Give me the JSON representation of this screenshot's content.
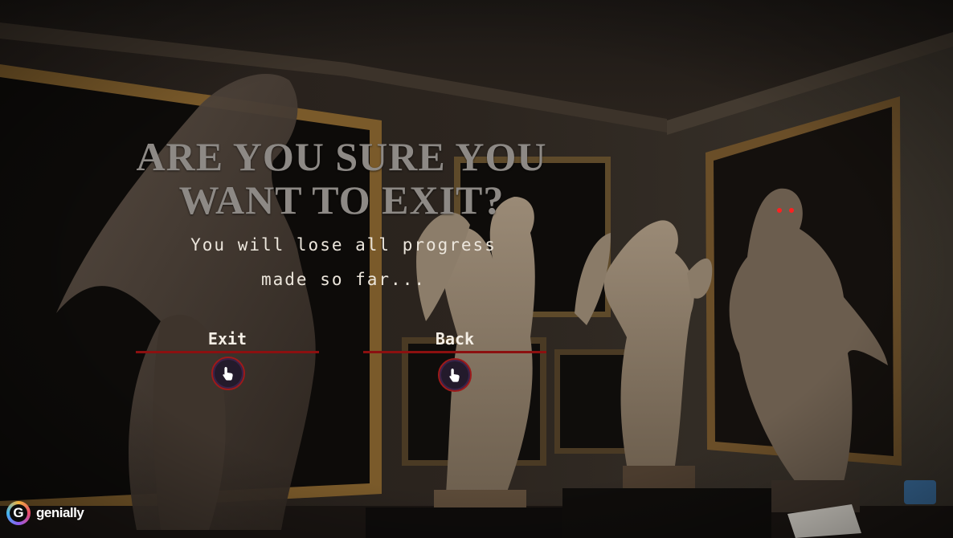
{
  "dialog": {
    "title_line1": "ARE YOU SURE YOU",
    "title_line2": "WANT TO EXIT?",
    "subtitle_line1": "You will lose all progress",
    "subtitle_line2": "made so far..."
  },
  "buttons": {
    "exit_label": "Exit",
    "back_label": "Back"
  },
  "icons": {
    "exit_hotspot": "hand-pointer-icon",
    "back_hotspot": "hand-pointer-icon",
    "brand": "genially-logo-icon"
  },
  "branding": {
    "logo_text": "genially",
    "logo_letter": "G"
  },
  "colors": {
    "underline": "#8c1010",
    "title": "#8d8985",
    "subtitle": "#ece6dc",
    "statue_eyes": "#ff2020"
  }
}
